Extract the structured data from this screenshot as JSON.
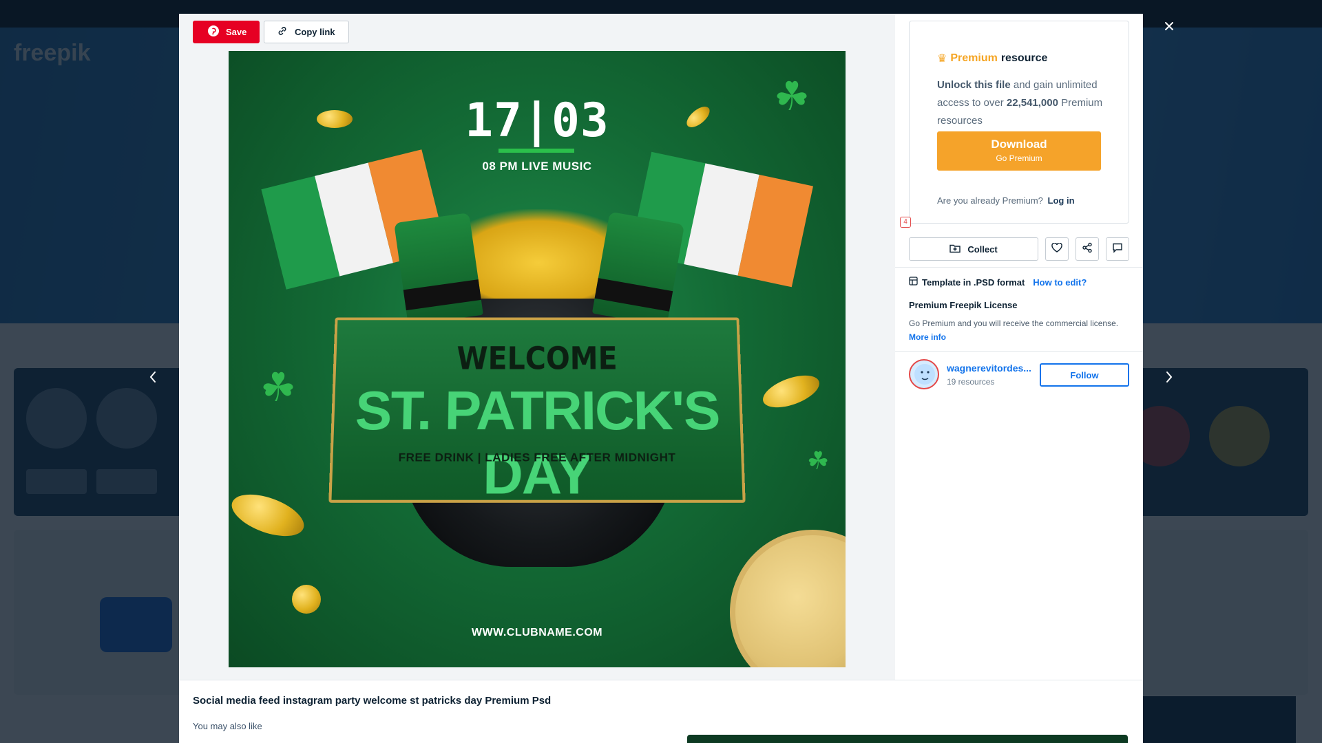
{
  "background": {
    "logo": "freepik"
  },
  "modal": {
    "save_label": "Save",
    "copy_link_label": "Copy link",
    "poster": {
      "date": "17|03",
      "time": "08 PM LIVE MUSIC",
      "welcome": "WELCOME",
      "title": "ST. PATRICK'S DAY",
      "subtitle": "FREE DRINK | LADIES FREE AFTER MIDNIGHT",
      "url": "WWW.CLUBNAME.COM"
    },
    "premium": {
      "title_highlight": "Premium",
      "title_rest": "resource",
      "unlock_bold": "Unlock this file",
      "unlock_rest": "and gain unlimited access to over",
      "count": "22,541,000",
      "count_rest": "Premium resources",
      "download_label": "Download",
      "download_sub": "Go Premium",
      "already_text": "Are you already Premium?",
      "login_label": "Log in"
    },
    "actions": {
      "collect_label": "Collect",
      "like_count": "4"
    },
    "template": {
      "format_text": "Template in .PSD format",
      "how_to_edit": "How to edit?"
    },
    "license": {
      "title": "Premium Freepik License",
      "text": "Go Premium and you will receive the commercial license.",
      "more_info": "More info"
    },
    "author": {
      "name": "wagnerevitordes...",
      "resources": "19 resources",
      "follow_label": "Follow"
    },
    "resource_title": "Social media feed instagram party welcome st patricks day Premium Psd",
    "you_may_also_like": "You may also like"
  },
  "colors": {
    "save_red": "#e60023",
    "premium_gold": "#f5a524",
    "download_orange": "#f5a32a",
    "link_blue": "#1273eb"
  }
}
